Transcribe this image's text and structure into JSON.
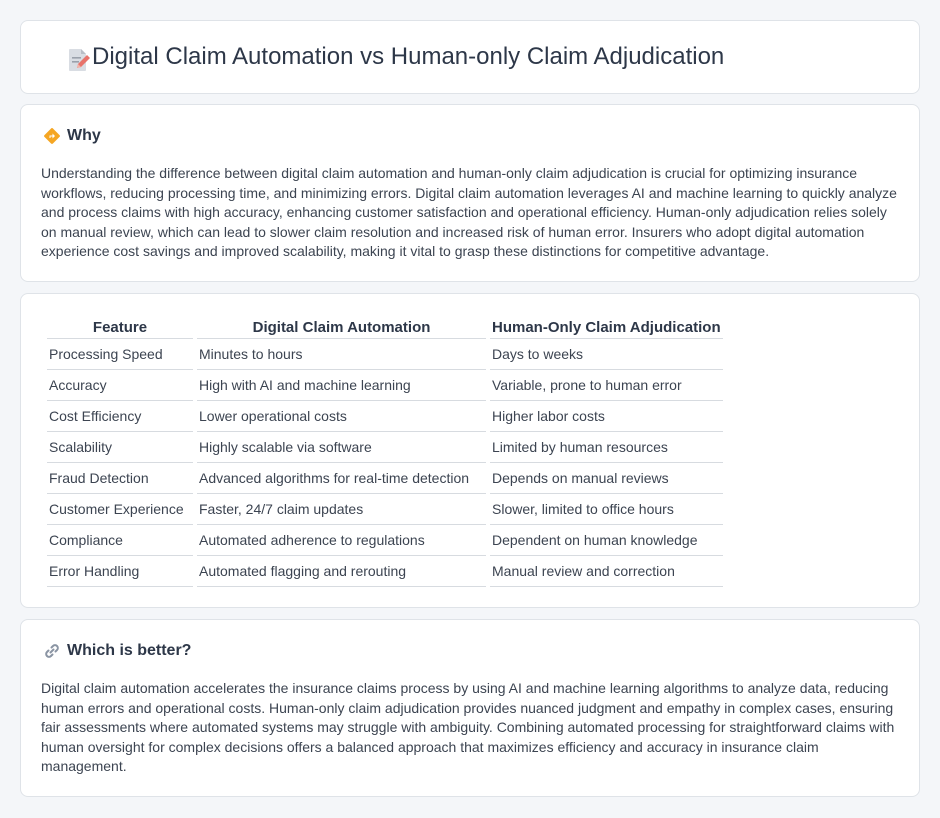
{
  "header": {
    "title": "Digital Claim Automation vs Human-only Claim Adjudication",
    "icon": "document-pencil-icon"
  },
  "why": {
    "heading": "Why",
    "icon": "diamond-sign-icon",
    "body": "Understanding the difference between digital claim automation and human-only claim adjudication is crucial for optimizing insurance workflows, reducing processing time, and minimizing errors. Digital claim automation leverages AI and machine learning to quickly analyze and process claims with high accuracy, enhancing customer satisfaction and operational efficiency. Human-only adjudication relies solely on manual review, which can lead to slower claim resolution and increased risk of human error. Insurers who adopt digital automation experience cost savings and improved scalability, making it vital to grasp these distinctions for competitive advantage."
  },
  "table": {
    "headers": [
      "Feature",
      "Digital Claim Automation",
      "Human-Only Claim Adjudication"
    ],
    "rows": [
      [
        "Processing Speed",
        "Minutes to hours",
        "Days to weeks"
      ],
      [
        "Accuracy",
        "High with AI and machine learning",
        "Variable, prone to human error"
      ],
      [
        "Cost Efficiency",
        "Lower operational costs",
        "Higher labor costs"
      ],
      [
        "Scalability",
        "Highly scalable via software",
        "Limited by human resources"
      ],
      [
        "Fraud Detection",
        "Advanced algorithms for real-time detection",
        "Depends on manual reviews"
      ],
      [
        "Customer Experience",
        "Faster, 24/7 claim updates",
        "Slower, limited to office hours"
      ],
      [
        "Compliance",
        "Automated adherence to regulations",
        "Dependent on human knowledge"
      ],
      [
        "Error Handling",
        "Automated flagging and rerouting",
        "Manual review and correction"
      ]
    ]
  },
  "better": {
    "heading": "Which is better?",
    "icon": "link-icon",
    "body": "Digital claim automation accelerates the insurance claims process by using AI and machine learning algorithms to analyze data, reducing human errors and operational costs. Human-only claim adjudication provides nuanced judgment and empathy in complex cases, ensuring fair assessments where automated systems may struggle with ambiguity. Combining automated processing for straightforward claims with human oversight for complex decisions offers a balanced approach that maximizes efficiency and accuracy in insurance claim management."
  },
  "colors": {
    "page_bg": "#f4f6f9",
    "card_bg": "#ffffff",
    "accent_orange": "#f5a623",
    "icon_pink": "#e8736b"
  }
}
